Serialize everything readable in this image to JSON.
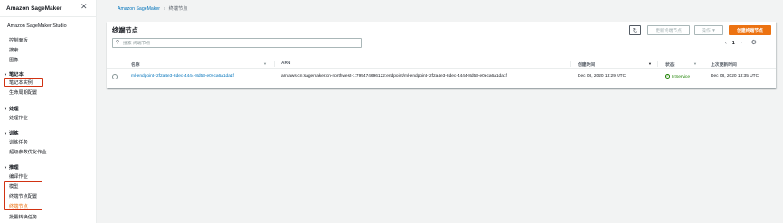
{
  "sidebar": {
    "title": "Amazon SageMaker",
    "studio": "Amazon SageMaker Studio",
    "top_items": [
      "控制面板",
      "搜索",
      "图像"
    ],
    "sections": [
      {
        "label": "笔记本",
        "items": [
          "笔记本实例",
          "生命周期配置"
        ]
      },
      {
        "label": "处理",
        "items": [
          "处理作业"
        ]
      },
      {
        "label": "训练",
        "items": [
          "训练任务",
          "超级参数优化作业"
        ]
      },
      {
        "label": "推理",
        "items": [
          "编译作业",
          "模型",
          "终端节点配置",
          "终端节点",
          "批量转换任务"
        ]
      }
    ]
  },
  "breadcrumb": {
    "root": "Amazon SageMaker",
    "current": "终端节点"
  },
  "panel": {
    "title": "终端节点",
    "refresh_icon": "refresh-icon",
    "update_button": "更新终端节点",
    "actions_button": "操作 ▼",
    "create_button": "创建终端节点",
    "search_placeholder": "搜索 终端节点",
    "page": "1"
  },
  "table": {
    "columns": [
      "名称",
      "ARN",
      "创建时间",
      "状态",
      "上次更新时间"
    ],
    "rows": [
      {
        "name": "ml-endpoint-f2f2a4e3-8dec-4444-8d53-e0eca6a1da1f",
        "arn": "arn:aws-cn:sagemaker:cn-northwest-1:795474696122:endpoint/ml-endpoint-f2f2a4e3-8dec-4444-8d53-e0eca6a1da1f",
        "created": "Dec 08, 2020 13:29 UTC",
        "status": "InService",
        "updated": "Dec 08, 2020 13:35 UTC"
      }
    ]
  },
  "colors": {
    "accent": "#ec7211",
    "link": "#0073bb",
    "success": "#1d8102",
    "highlight": "#d13212"
  }
}
